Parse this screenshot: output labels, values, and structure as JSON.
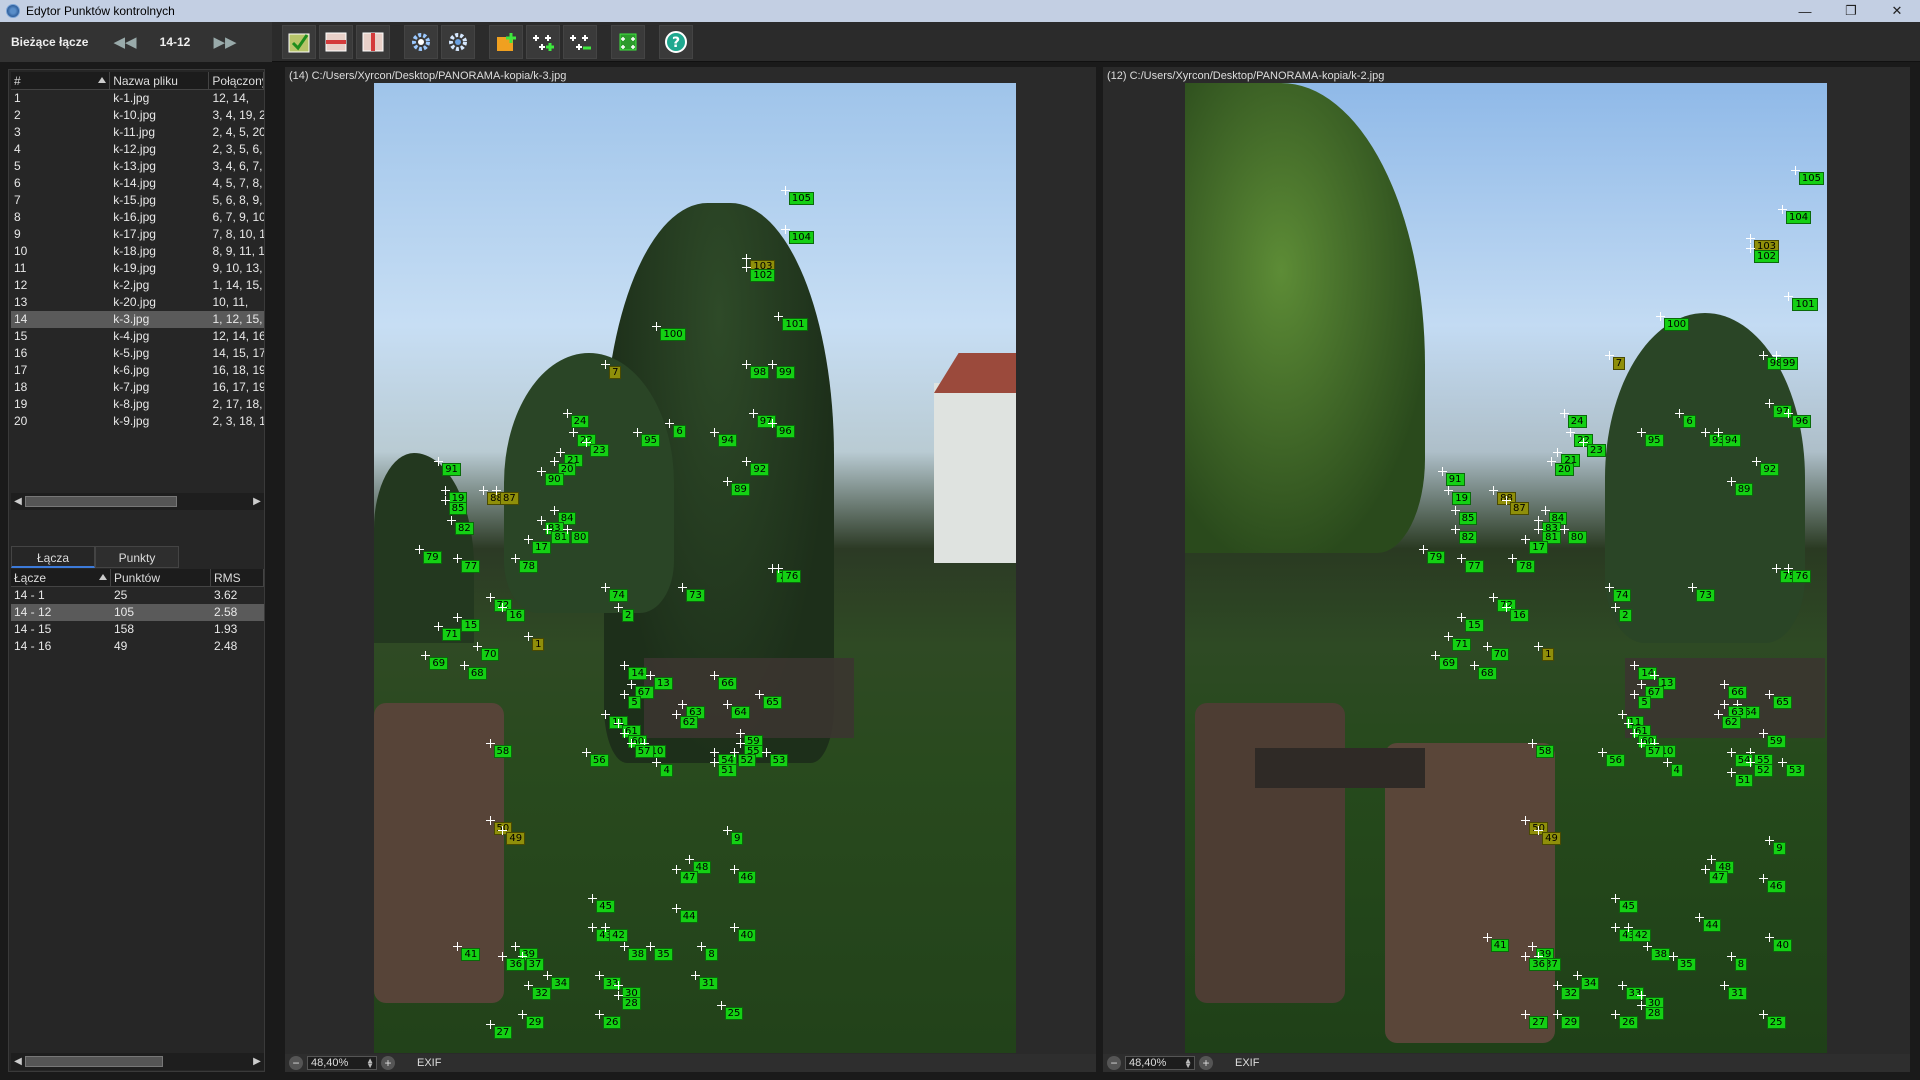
{
  "window": {
    "title": "Edytor Punktów kontrolnych",
    "buttons": [
      "—",
      "❐",
      "✕"
    ]
  },
  "nav": {
    "label": "Bieżące łącze",
    "value": "14-12"
  },
  "toolbar": {
    "icons": [
      "accept-icon",
      "split-horizontal-icon",
      "split-vertical-icon",
      "gear-detect-icon",
      "gear-settings-icon",
      "add-point-icon",
      "add-points-icon",
      "remove-points-icon",
      "optimize-icon",
      "help-icon"
    ]
  },
  "files_table": {
    "headers": [
      "#",
      "Nazwa pliku",
      "Połączony"
    ],
    "rows": [
      [
        "1",
        "k-1.jpg",
        "12, 14,"
      ],
      [
        "2",
        "k-10.jpg",
        "3, 4, 19, 20"
      ],
      [
        "3",
        "k-11.jpg",
        "2, 4, 5, 20,"
      ],
      [
        "4",
        "k-12.jpg",
        "2, 3, 5, 6,"
      ],
      [
        "5",
        "k-13.jpg",
        "3, 4, 6, 7,"
      ],
      [
        "6",
        "k-14.jpg",
        "4, 5, 7, 8,"
      ],
      [
        "7",
        "k-15.jpg",
        "5, 6, 8, 9,"
      ],
      [
        "8",
        "k-16.jpg",
        "6, 7, 9, 10,"
      ],
      [
        "9",
        "k-17.jpg",
        "7, 8, 10, 11"
      ],
      [
        "10",
        "k-18.jpg",
        "8, 9, 11, 13"
      ],
      [
        "11",
        "k-19.jpg",
        "9, 10, 13,"
      ],
      [
        "12",
        "k-2.jpg",
        "1, 14, 15,"
      ],
      [
        "13",
        "k-20.jpg",
        "10, 11,"
      ],
      [
        "14",
        "k-3.jpg",
        "1, 12, 15, 1"
      ],
      [
        "15",
        "k-4.jpg",
        "12, 14, 16,"
      ],
      [
        "16",
        "k-5.jpg",
        "14, 15, 17,"
      ],
      [
        "17",
        "k-6.jpg",
        "16, 18, 19,"
      ],
      [
        "18",
        "k-7.jpg",
        "16, 17, 19,"
      ],
      [
        "19",
        "k-8.jpg",
        "2, 17, 18, 2"
      ],
      [
        "20",
        "k-9.jpg",
        "2, 3, 18, 19"
      ]
    ],
    "selected_index": 13
  },
  "tabs": [
    "Łącza",
    "Punkty"
  ],
  "links_table": {
    "headers": [
      "Łącze",
      "Punktów",
      "RMS"
    ],
    "rows": [
      [
        "14 - 1",
        "25",
        "3.62"
      ],
      [
        "14 - 12",
        "105",
        "2.58"
      ],
      [
        "14 - 15",
        "158",
        "1.93"
      ],
      [
        "14 - 16",
        "49",
        "2.48"
      ]
    ],
    "selected_index": 1
  },
  "left_pane": {
    "path": "(14) C:/Users/Xyrcon/Desktop/PANORAMA-kopia/k-3.jpg",
    "zoom": "48,40%",
    "exif": "EXIF"
  },
  "right_pane": {
    "path": "(12) C:/Users/Xyrcon/Desktop/PANORAMA-kopia/k-2.jpg",
    "zoom": "48,40%",
    "exif": "EXIF"
  },
  "control_points_left": [
    [
      "105",
      0.64,
      0.11
    ],
    [
      "104",
      0.64,
      0.15
    ],
    [
      "103",
      0.58,
      0.18
    ],
    [
      "102",
      0.58,
      0.19
    ],
    [
      "101",
      0.63,
      0.24
    ],
    [
      "100",
      0.44,
      0.25
    ],
    [
      "7",
      0.36,
      0.29
    ],
    [
      "98",
      0.58,
      0.29
    ],
    [
      "99",
      0.62,
      0.29
    ],
    [
      "97",
      0.59,
      0.34
    ],
    [
      "96",
      0.62,
      0.35
    ],
    [
      "6",
      0.46,
      0.35
    ],
    [
      "95",
      0.41,
      0.36
    ],
    [
      "94",
      0.53,
      0.36
    ],
    [
      "24",
      0.3,
      0.34
    ],
    [
      "22",
      0.31,
      0.36
    ],
    [
      "23",
      0.33,
      0.37
    ],
    [
      "21",
      0.29,
      0.38
    ],
    [
      "20",
      0.28,
      0.39
    ],
    [
      "90",
      0.26,
      0.4
    ],
    [
      "92",
      0.58,
      0.39
    ],
    [
      "91",
      0.1,
      0.39
    ],
    [
      "19",
      0.11,
      0.42
    ],
    [
      "89",
      0.55,
      0.41
    ],
    [
      "88",
      0.17,
      0.42
    ],
    [
      "87",
      0.19,
      0.42
    ],
    [
      "85",
      0.11,
      0.43
    ],
    [
      "84",
      0.28,
      0.44
    ],
    [
      "83",
      0.26,
      0.45
    ],
    [
      "82",
      0.12,
      0.45
    ],
    [
      "81",
      0.27,
      0.46
    ],
    [
      "80",
      0.3,
      0.46
    ],
    [
      "17",
      0.24,
      0.47
    ],
    [
      "79",
      0.07,
      0.48
    ],
    [
      "78",
      0.22,
      0.49
    ],
    [
      "77",
      0.13,
      0.49
    ],
    [
      "75",
      0.62,
      0.5
    ],
    [
      "76",
      0.63,
      0.5
    ],
    [
      "74",
      0.36,
      0.52
    ],
    [
      "73",
      0.48,
      0.52
    ],
    [
      "72",
      0.18,
      0.53
    ],
    [
      "16",
      0.2,
      0.54
    ],
    [
      "2",
      0.38,
      0.54
    ],
    [
      "15",
      0.13,
      0.55
    ],
    [
      "71",
      0.1,
      0.56
    ],
    [
      "70",
      0.16,
      0.58
    ],
    [
      "1",
      0.24,
      0.57
    ],
    [
      "69",
      0.08,
      0.59
    ],
    [
      "68",
      0.14,
      0.6
    ],
    [
      "14",
      0.39,
      0.6
    ],
    [
      "13",
      0.43,
      0.61
    ],
    [
      "67",
      0.4,
      0.62
    ],
    [
      "66",
      0.53,
      0.61
    ],
    [
      "5",
      0.39,
      0.63
    ],
    [
      "65",
      0.6,
      0.63
    ],
    [
      "64",
      0.55,
      0.64
    ],
    [
      "63",
      0.48,
      0.64
    ],
    [
      "62",
      0.47,
      0.65
    ],
    [
      "11",
      0.36,
      0.65
    ],
    [
      "61",
      0.38,
      0.66
    ],
    [
      "59",
      0.57,
      0.67
    ],
    [
      "60",
      0.39,
      0.67
    ],
    [
      "10",
      0.42,
      0.68
    ],
    [
      "57",
      0.4,
      0.68
    ],
    [
      "55",
      0.57,
      0.68
    ],
    [
      "54",
      0.53,
      0.69
    ],
    [
      "56",
      0.33,
      0.69
    ],
    [
      "53",
      0.61,
      0.69
    ],
    [
      "52",
      0.56,
      0.69
    ],
    [
      "58",
      0.18,
      0.68
    ],
    [
      "4",
      0.44,
      0.7
    ],
    [
      "51",
      0.53,
      0.7
    ],
    [
      "50",
      0.18,
      0.76
    ],
    [
      "49",
      0.2,
      0.77
    ],
    [
      "9",
      0.55,
      0.77
    ],
    [
      "48",
      0.49,
      0.8
    ],
    [
      "47",
      0.47,
      0.81
    ],
    [
      "46",
      0.56,
      0.81
    ],
    [
      "45",
      0.34,
      0.84
    ],
    [
      "44",
      0.47,
      0.85
    ],
    [
      "40",
      0.56,
      0.87
    ],
    [
      "43",
      0.34,
      0.87
    ],
    [
      "42",
      0.36,
      0.87
    ],
    [
      "39",
      0.22,
      0.89
    ],
    [
      "38",
      0.39,
      0.89
    ],
    [
      "37",
      0.23,
      0.9
    ],
    [
      "36",
      0.2,
      0.9
    ],
    [
      "41",
      0.13,
      0.89
    ],
    [
      "35",
      0.43,
      0.89
    ],
    [
      "8",
      0.51,
      0.89
    ],
    [
      "34",
      0.27,
      0.92
    ],
    [
      "33",
      0.35,
      0.92
    ],
    [
      "31",
      0.5,
      0.92
    ],
    [
      "32",
      0.24,
      0.93
    ],
    [
      "30",
      0.38,
      0.93
    ],
    [
      "28",
      0.38,
      0.94
    ],
    [
      "25",
      0.54,
      0.95
    ],
    [
      "29",
      0.23,
      0.96
    ],
    [
      "26",
      0.35,
      0.96
    ],
    [
      "27",
      0.18,
      0.97
    ]
  ],
  "control_points_right": [
    [
      "105",
      0.95,
      0.09
    ],
    [
      "104",
      0.93,
      0.13
    ],
    [
      "103",
      0.88,
      0.16
    ],
    [
      "102",
      0.88,
      0.17
    ],
    [
      "101",
      0.94,
      0.22
    ],
    [
      "100",
      0.74,
      0.24
    ],
    [
      "7",
      0.66,
      0.28
    ],
    [
      "98",
      0.9,
      0.28
    ],
    [
      "99",
      0.92,
      0.28
    ],
    [
      "97",
      0.91,
      0.33
    ],
    [
      "96",
      0.94,
      0.34
    ],
    [
      "6",
      0.77,
      0.34
    ],
    [
      "95",
      0.71,
      0.36
    ],
    [
      "93",
      0.81,
      0.36
    ],
    [
      "94",
      0.83,
      0.36
    ],
    [
      "24",
      0.59,
      0.34
    ],
    [
      "22",
      0.6,
      0.36
    ],
    [
      "23",
      0.62,
      0.37
    ],
    [
      "21",
      0.58,
      0.38
    ],
    [
      "20",
      0.57,
      0.39
    ],
    [
      "92",
      0.89,
      0.39
    ],
    [
      "91",
      0.4,
      0.4
    ],
    [
      "19",
      0.41,
      0.42
    ],
    [
      "89",
      0.85,
      0.41
    ],
    [
      "88",
      0.48,
      0.42
    ],
    [
      "87",
      0.5,
      0.43
    ],
    [
      "85",
      0.42,
      0.44
    ],
    [
      "84",
      0.56,
      0.44
    ],
    [
      "83",
      0.55,
      0.45
    ],
    [
      "82",
      0.42,
      0.46
    ],
    [
      "81",
      0.55,
      0.46
    ],
    [
      "80",
      0.59,
      0.46
    ],
    [
      "17",
      0.53,
      0.47
    ],
    [
      "79",
      0.37,
      0.48
    ],
    [
      "78",
      0.51,
      0.49
    ],
    [
      "77",
      0.43,
      0.49
    ],
    [
      "75",
      0.92,
      0.5
    ],
    [
      "76",
      0.94,
      0.5
    ],
    [
      "74",
      0.66,
      0.52
    ],
    [
      "73",
      0.79,
      0.52
    ],
    [
      "72",
      0.48,
      0.53
    ],
    [
      "16",
      0.5,
      0.54
    ],
    [
      "2",
      0.67,
      0.54
    ],
    [
      "15",
      0.43,
      0.55
    ],
    [
      "71",
      0.41,
      0.57
    ],
    [
      "70",
      0.47,
      0.58
    ],
    [
      "1",
      0.55,
      0.58
    ],
    [
      "69",
      0.39,
      0.59
    ],
    [
      "68",
      0.45,
      0.6
    ],
    [
      "14",
      0.7,
      0.6
    ],
    [
      "13",
      0.73,
      0.61
    ],
    [
      "67",
      0.71,
      0.62
    ],
    [
      "66",
      0.84,
      0.62
    ],
    [
      "5",
      0.7,
      0.63
    ],
    [
      "65",
      0.91,
      0.63
    ],
    [
      "64",
      0.86,
      0.64
    ],
    [
      "63",
      0.84,
      0.64
    ],
    [
      "62",
      0.83,
      0.65
    ],
    [
      "11",
      0.68,
      0.65
    ],
    [
      "61",
      0.69,
      0.66
    ],
    [
      "59",
      0.9,
      0.67
    ],
    [
      "60",
      0.7,
      0.67
    ],
    [
      "10",
      0.73,
      0.68
    ],
    [
      "57",
      0.71,
      0.68
    ],
    [
      "55",
      0.88,
      0.69
    ],
    [
      "54",
      0.85,
      0.69
    ],
    [
      "56",
      0.65,
      0.69
    ],
    [
      "53",
      0.93,
      0.7
    ],
    [
      "52",
      0.88,
      0.7
    ],
    [
      "58",
      0.54,
      0.68
    ],
    [
      "4",
      0.75,
      0.7
    ],
    [
      "51",
      0.85,
      0.71
    ],
    [
      "50",
      0.53,
      0.76
    ],
    [
      "49",
      0.55,
      0.77
    ],
    [
      "9",
      0.91,
      0.78
    ],
    [
      "48",
      0.82,
      0.8
    ],
    [
      "47",
      0.81,
      0.81
    ],
    [
      "46",
      0.9,
      0.82
    ],
    [
      "45",
      0.67,
      0.84
    ],
    [
      "44",
      0.8,
      0.86
    ],
    [
      "40",
      0.91,
      0.88
    ],
    [
      "43",
      0.67,
      0.87
    ],
    [
      "42",
      0.69,
      0.87
    ],
    [
      "39",
      0.54,
      0.89
    ],
    [
      "38",
      0.72,
      0.89
    ],
    [
      "37",
      0.55,
      0.9
    ],
    [
      "36",
      0.53,
      0.9
    ],
    [
      "41",
      0.47,
      0.88
    ],
    [
      "35",
      0.76,
      0.9
    ],
    [
      "8",
      0.85,
      0.9
    ],
    [
      "34",
      0.61,
      0.92
    ],
    [
      "33",
      0.68,
      0.93
    ],
    [
      "31",
      0.84,
      0.93
    ],
    [
      "32",
      0.58,
      0.93
    ],
    [
      "30",
      0.71,
      0.94
    ],
    [
      "28",
      0.71,
      0.95
    ],
    [
      "25",
      0.9,
      0.96
    ],
    [
      "29",
      0.58,
      0.96
    ],
    [
      "26",
      0.67,
      0.96
    ],
    [
      "27",
      0.53,
      0.96
    ]
  ],
  "olive_points": [
    "103",
    "1",
    "49",
    "50",
    "87",
    "88",
    "7"
  ],
  "colors": {
    "point_green": "#14d014",
    "point_olive": "#8f8f0a",
    "selection": "#5a5a5a",
    "tab_accent": "#3c7ad9"
  }
}
